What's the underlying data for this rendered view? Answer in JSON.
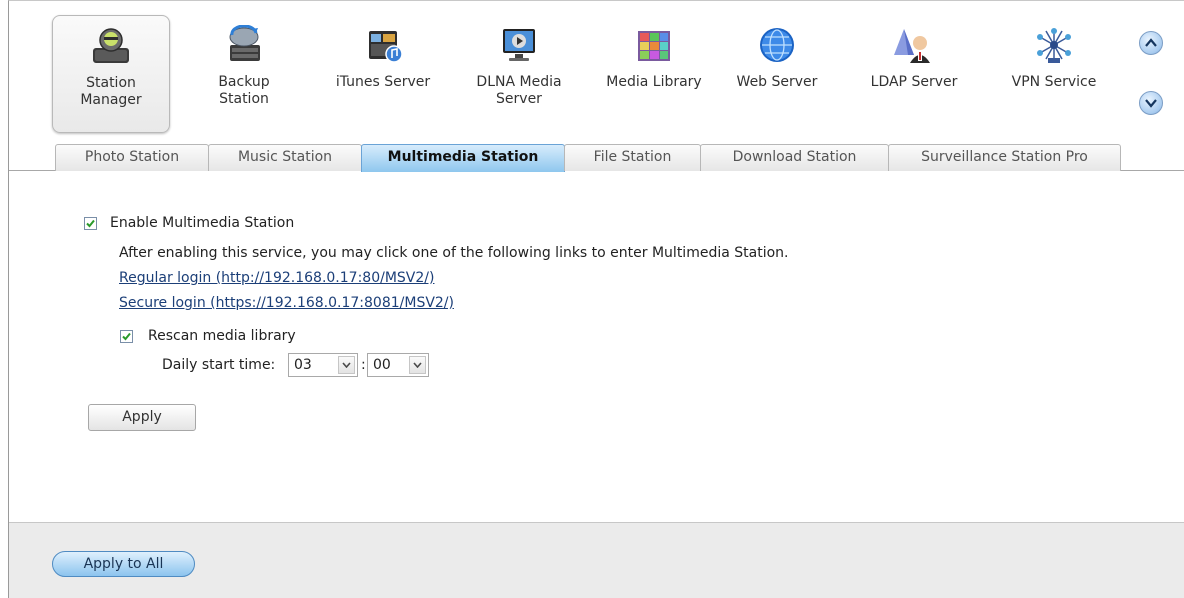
{
  "apps": [
    {
      "label": "Station Manager",
      "active": true
    },
    {
      "label": "Backup Station"
    },
    {
      "label": "iTunes Server"
    },
    {
      "label": "DLNA Media Server"
    },
    {
      "label": "Media Library"
    },
    {
      "label": "Web Server"
    },
    {
      "label": "LDAP Server"
    },
    {
      "label": "VPN Service"
    }
  ],
  "appLabels": {
    "station_manager_1": "Station",
    "station_manager_2": "Manager",
    "backup_1": "Backup",
    "backup_2": "Station",
    "itunes": "iTunes Server",
    "dlna_1": "DLNA Media",
    "dlna_2": "Server",
    "media_library": "Media Library",
    "web_server": "Web Server",
    "ldap_server": "LDAP Server",
    "vpn_service": "VPN Service"
  },
  "tabs": {
    "photo": "Photo Station",
    "music": "Music Station",
    "multimedia": "Multimedia Station",
    "file": "File Station",
    "download": "Download Station",
    "surveillance": "Surveillance Station Pro"
  },
  "activeTab": "Multimedia Station",
  "content": {
    "enable_label": "Enable Multimedia Station",
    "enable_checked": true,
    "info_text": "After enabling this service, you may click one of the following links to enter Multimedia Station.",
    "regular_login": "Regular login (http://192.168.0.17:80/MSV2/)",
    "secure_login": "Secure login (https://192.168.0.17:8081/MSV2/)",
    "rescan_label": "Rescan media library",
    "rescan_checked": true,
    "daily_label": "Daily start time:",
    "hour": "03",
    "separator": ":",
    "minute": "00",
    "apply": "Apply"
  },
  "footer": {
    "apply_all": "Apply to All"
  },
  "colors": {
    "active_tab": "#8fc7ee",
    "link": "#1c3f78",
    "footer_bg": "#ebebeb",
    "check": "#2a9a2a"
  }
}
